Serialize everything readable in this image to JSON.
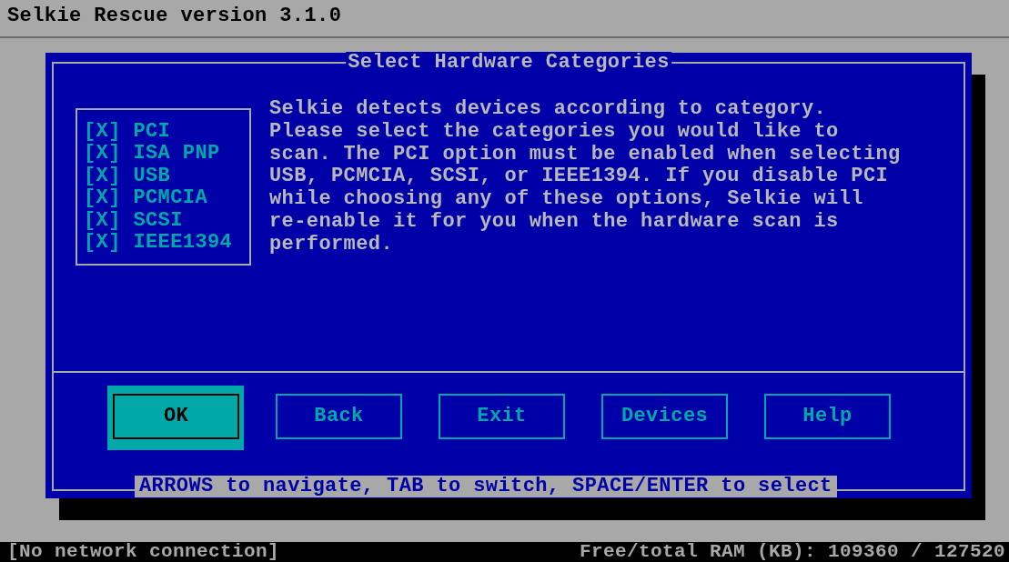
{
  "app_title": "Selkie Rescue version 3.1.0",
  "dialog": {
    "title": "Select Hardware Categories",
    "categories": [
      {
        "box": "[X]",
        "label": "PCI",
        "checked": true
      },
      {
        "box": "[X]",
        "label": "ISA PNP",
        "checked": true
      },
      {
        "box": "[X]",
        "label": "USB",
        "checked": true
      },
      {
        "box": "[X]",
        "label": "PCMCIA",
        "checked": true
      },
      {
        "box": "[X]",
        "label": "SCSI",
        "checked": true
      },
      {
        "box": "[X]",
        "label": "IEEE1394",
        "checked": true
      }
    ],
    "description": "Selkie detects devices according to category. Please select the categories you would like to scan. The PCI option must be enabled when selecting USB, PCMCIA, SCSI, or IEEE1394. If you disable PCI while choosing any of these options, Selkie will re-enable it for you when the hardware scan is performed.",
    "buttons": [
      {
        "label": "OK",
        "selected": true
      },
      {
        "label": "Back",
        "selected": false
      },
      {
        "label": "Exit",
        "selected": false
      },
      {
        "label": "Devices",
        "selected": false
      },
      {
        "label": "Help",
        "selected": false
      }
    ],
    "hint": "ARROWS to navigate, TAB to switch, SPACE/ENTER to select"
  },
  "status_bar": {
    "network": "[No network connection]",
    "memory": "Free/total RAM (KB): 109360 / 127520"
  }
}
